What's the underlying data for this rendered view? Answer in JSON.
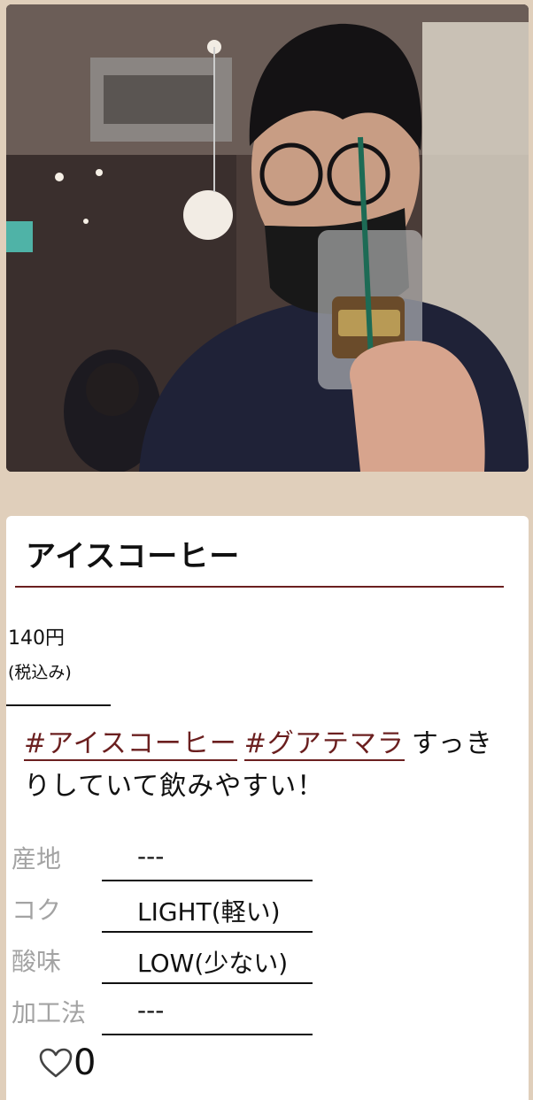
{
  "post": {
    "title": "アイスコーヒー",
    "price": "140円",
    "tax_note": "(税込み)",
    "tags": [
      "#アイスコーヒー",
      "#グアテマラ"
    ],
    "comment": "すっきりしていて飲みやすい！",
    "attributes": [
      {
        "label": "産地",
        "value": "---"
      },
      {
        "label": "コク",
        "value": "LIGHT(軽い)"
      },
      {
        "label": "酸味",
        "value": "LOW(少ない)"
      },
      {
        "label": "加工法",
        "value": "---"
      }
    ],
    "likes": "0"
  },
  "colors": {
    "background": "#e0cfbb",
    "accent": "#6b1f1f",
    "label_gray": "#a3a3a3"
  },
  "icons": {
    "like": "heart-outline-icon"
  }
}
